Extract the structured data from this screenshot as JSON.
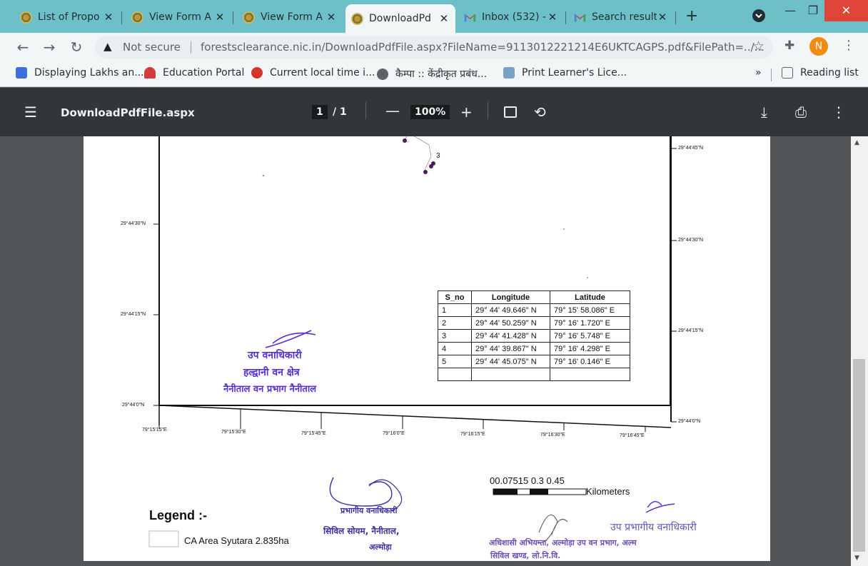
{
  "tabs": [
    {
      "label": "List of Propo",
      "icon": "emblem-icon",
      "active": false
    },
    {
      "label": "View Form A",
      "icon": "emblem-icon",
      "active": false
    },
    {
      "label": "View Form A",
      "icon": "emblem-icon",
      "active": false
    },
    {
      "label": "DownloadPd",
      "icon": "emblem-icon",
      "active": true
    },
    {
      "label": "Inbox (532) -",
      "icon": "gmail-icon",
      "active": false
    },
    {
      "label": "Search result",
      "icon": "gmail-icon",
      "active": false
    }
  ],
  "address": {
    "security_label": "Not secure",
    "url": "forestsclearance.nic.in/DownloadPdfFile.aspx?FileName=9113012221214E6UKTCAGPS.pdf&FilePath=../...",
    "avatar_letter": "N"
  },
  "bookmarks": [
    {
      "label": "Displaying Lakhs an...",
      "color": "#3c6fd9"
    },
    {
      "label": "Education Portal",
      "color": "#d23c3c"
    },
    {
      "label": "Current local time i...",
      "color": "#d2372a"
    },
    {
      "label": "कैम्पा :: केंद्रीकृत प्रबंध...",
      "color": "#5f6368"
    },
    {
      "label": "Print Learner's Lice...",
      "color": "#7aa0c8"
    }
  ],
  "bookmarks_overflow": "»",
  "reading_list": "Reading list",
  "pdf": {
    "filename": "DownloadPdfFile.aspx",
    "page_current": "1",
    "page_total": "/ 1",
    "zoom": "100%"
  },
  "map": {
    "lat_labels_left": [
      "29°44'30\"N",
      "29°44'15\"N",
      "29°44'0\"N"
    ],
    "lat_labels_right": [
      "29°44'45\"N",
      "29°44'30\"N",
      "29°44'15\"N",
      "29°44'0\"N"
    ],
    "lon_labels": [
      "79°15'15\"E",
      "79°15'30\"E",
      "79°15'45\"E",
      "79°16'0\"E",
      "79°16'15\"E",
      "79°16'30\"E",
      "79°16'45\"E"
    ],
    "point_label": "3",
    "table_headers": [
      "S_no",
      "Longitude",
      "Latitude"
    ],
    "table_rows": [
      [
        "1",
        "29° 44' 49.646\" N",
        "79° 15' 58.086\" E"
      ],
      [
        "2",
        "29° 44' 50.259\" N",
        "79° 16' 1.720\" E"
      ],
      [
        "3",
        "29° 44' 41.428\" N",
        "79° 16' 5.748\" E"
      ],
      [
        "4",
        "29° 44' 39.867\" N",
        "79° 16' 4.298\" E"
      ],
      [
        "5",
        "29° 44' 45.075\" N",
        "79° 16' 0.146\" E"
      ],
      [
        "",
        "",
        ""
      ]
    ],
    "scale_numbers": "00.07515   0.3   0.45",
    "scale_unit": "Kilometers",
    "legend_title": "Legend :-",
    "legend_item": "CA Area Syutara 2.835ha",
    "stamp_left": [
      "उप वनाधिकारी",
      "हल्द्वानी वन क्षेत्र",
      "नैनीताल वन प्रभाग नैनीताल"
    ],
    "stamp_middle": [
      "प्रभागीय वनाधिकारी",
      "सिविल सोयम, नैनीताल,",
      "अल्मोड़ा"
    ],
    "stamp_right": [
      "उप प्रभागीय वनाधिकारी",
      "अधिशासी अभियन्ता, अल्मोड़ा उप वन प्रभाग, अल्म",
      "सिविल खण्ड, लो.नि.वि."
    ]
  }
}
